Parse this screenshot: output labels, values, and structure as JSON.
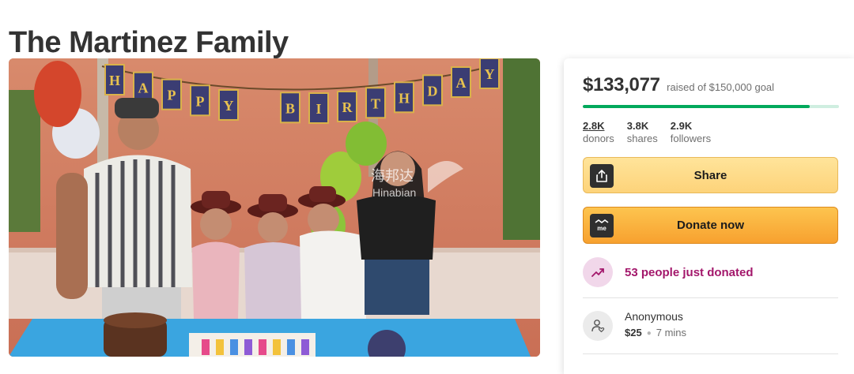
{
  "page": {
    "title": "The Martinez Family"
  },
  "photo": {
    "banner_letters": [
      "H",
      "A",
      "P",
      "P",
      "Y",
      "B",
      "I",
      "R",
      "T",
      "H",
      "D",
      "A",
      "Y"
    ],
    "watermark_cn": "海邦达",
    "watermark_en": "Hinabian"
  },
  "fundraiser": {
    "raised_amount": "$133,077",
    "raised_text": "raised of $150,000 goal",
    "progress_fraction": 0.887,
    "stats": [
      {
        "value": "2.8K",
        "label": "donors"
      },
      {
        "value": "3.8K",
        "label": "shares"
      },
      {
        "value": "2.9K",
        "label": "followers"
      }
    ],
    "share_label": "Share",
    "donate_label": "Donate now",
    "just_donated_text": "53 people just donated",
    "recent_donation": {
      "name": "Anonymous",
      "amount": "$25",
      "time": "7 mins"
    }
  },
  "colors": {
    "progress": "#02a95c",
    "accent_purple": "#a3176b",
    "share_button": "#fdd37a",
    "donate_button": "#f7a12f"
  },
  "icons": {
    "share": "share-upload-icon",
    "donate": "me-badge-icon",
    "trending": "trending-up-icon",
    "donor": "user-heart-icon"
  }
}
